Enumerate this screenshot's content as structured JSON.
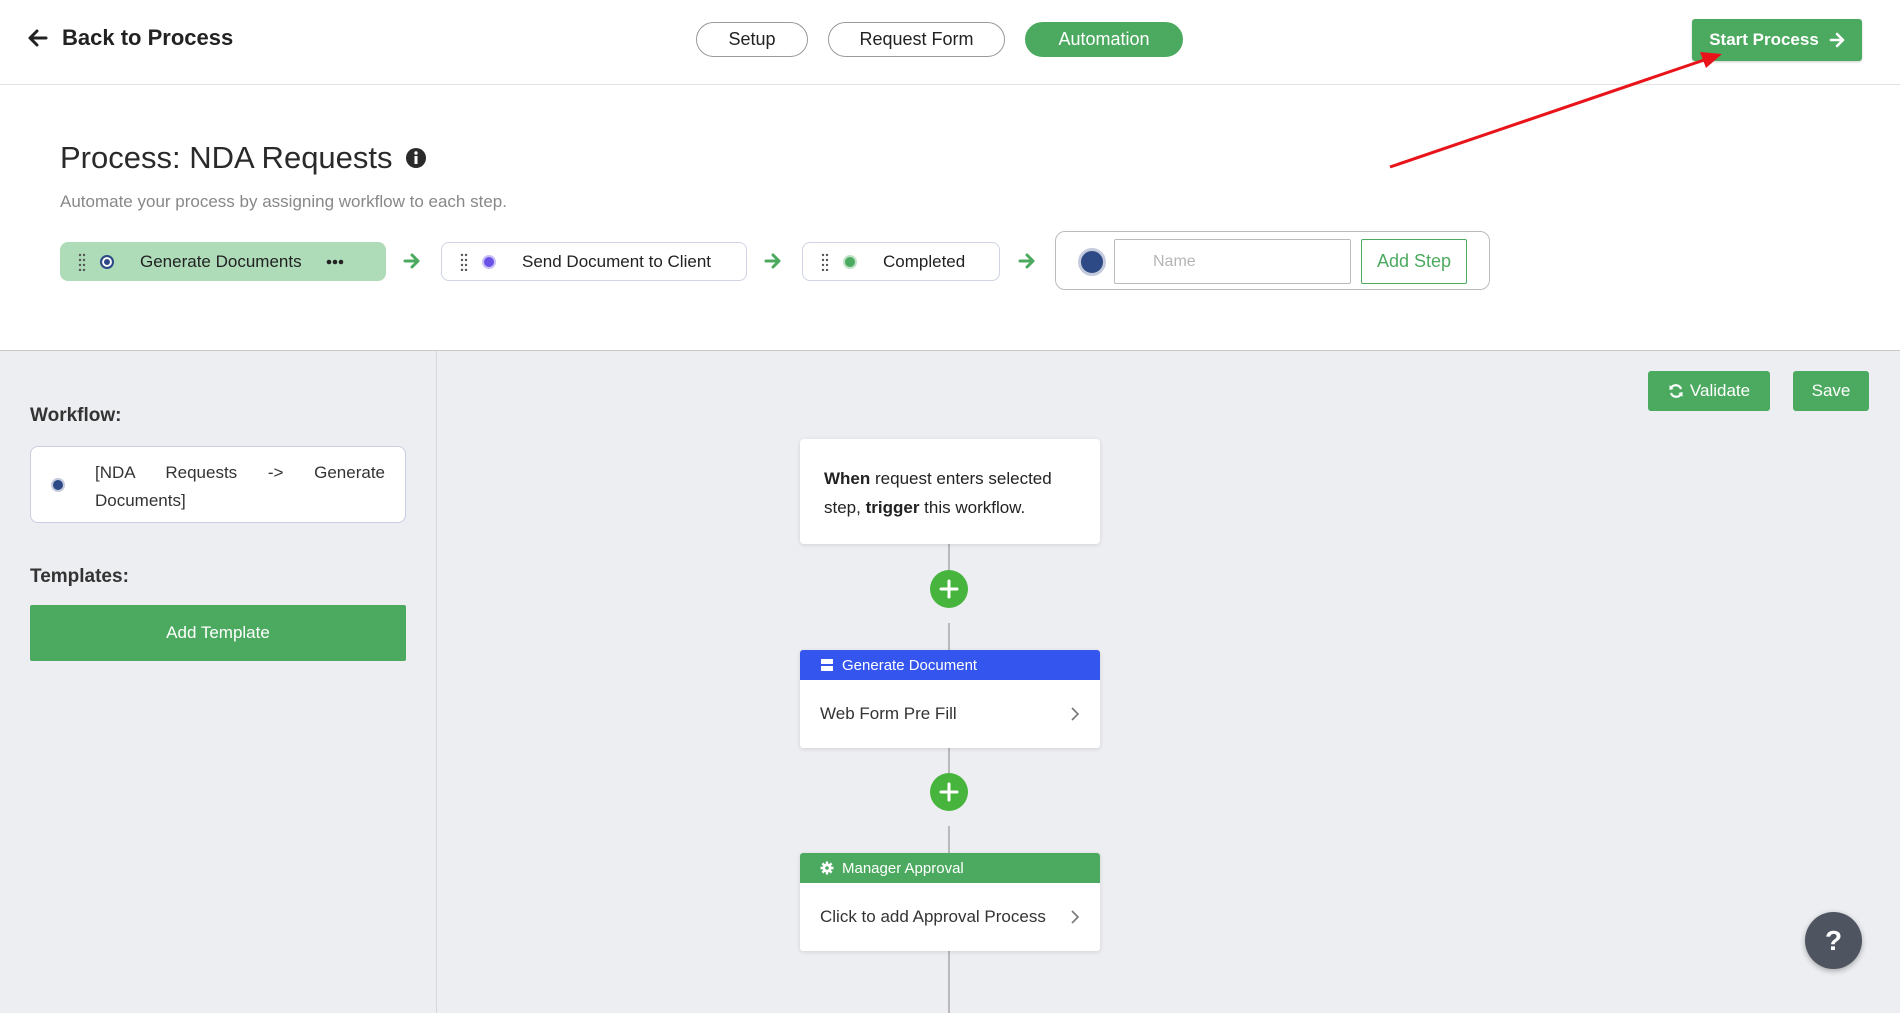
{
  "topbar": {
    "back_label": "Back to Process",
    "tabs": [
      {
        "label": "Setup",
        "active": false
      },
      {
        "label": "Request Form",
        "active": false
      },
      {
        "label": "Automation",
        "active": true
      }
    ],
    "start_label": "Start Process"
  },
  "process": {
    "title": "Process: NDA Requests",
    "subtitle": "Automate your process by assigning workflow to each step.",
    "steps": [
      {
        "label": "Generate Documents",
        "dot_color": "#2d4a86"
      },
      {
        "label": "Send Document to Client",
        "dot_color": "#6b52e6"
      },
      {
        "label": "Completed",
        "dot_color": "#4caa60"
      }
    ],
    "new_step": {
      "placeholder": "Name",
      "add_label": "Add Step"
    }
  },
  "sidebar": {
    "workflow_label": "Workflow:",
    "workflow_item": "[NDA Requests -> Generate Documents]",
    "templates_label": "Templates:",
    "add_template_label": "Add Template"
  },
  "canvas": {
    "validate_label": "Validate",
    "save_label": "Save",
    "trigger": {
      "when": "When",
      "text1": " request enters selected step, ",
      "trigger": "trigger",
      "text2": " this workflow."
    },
    "cards": [
      {
        "header": "Generate Document",
        "body": "Web Form Pre Fill",
        "color": "#3555ef"
      },
      {
        "header": "Manager Approval",
        "body": "Click to add Approval Process",
        "color": "#4caa60"
      }
    ],
    "help_label": "?"
  },
  "colors": {
    "accent": "#4caa60",
    "annotation": "#e8141a"
  }
}
